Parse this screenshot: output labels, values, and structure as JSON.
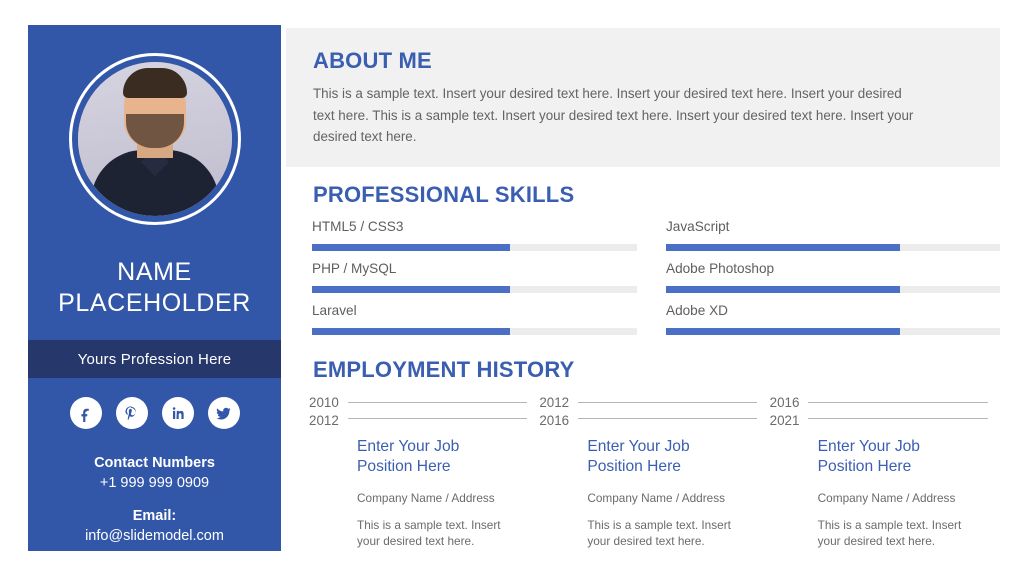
{
  "sidebar": {
    "avatar_alt": "profile-photo",
    "name_line1": "NAME",
    "name_line2": "PLACEHOLDER",
    "profession": "Yours Profession Here",
    "socials": [
      {
        "name": "facebook-icon",
        "label": "Facebook"
      },
      {
        "name": "pinterest-icon",
        "label": "Pinterest"
      },
      {
        "name": "linkedin-icon",
        "label": "LinkedIn"
      },
      {
        "name": "twitter-icon",
        "label": "Twitter"
      }
    ],
    "contact": {
      "phone_label": "Contact Numbers",
      "phone_value": "+1 999 999 0909",
      "email_label": "Email:",
      "email_value": "info@slidemodel.com"
    }
  },
  "about": {
    "title": "ABOUT ME",
    "body": "This is a sample text. Insert your desired text here. Insert your desired text here. Insert your desired text here. This is a sample text. Insert your desired text here. Insert your desired text here. Insert your desired text here."
  },
  "skills": {
    "title": "PROFESSIONAL SKILLS",
    "items": [
      {
        "name": "HTML5 / CSS3",
        "level": 61,
        "column": "left"
      },
      {
        "name": "JavaScript",
        "level": 70,
        "column": "right"
      },
      {
        "name": "PHP / MySQL",
        "level": 61,
        "column": "left"
      },
      {
        "name": "Adobe Photoshop",
        "level": 70,
        "column": "right"
      },
      {
        "name": "Laravel",
        "level": 61,
        "column": "left"
      },
      {
        "name": "Adobe XD",
        "level": 70,
        "column": "right"
      }
    ]
  },
  "employment": {
    "title": "EMPLOYMENT HISTORY",
    "entries": [
      {
        "year_from": "2010",
        "year_to": "2012",
        "role_line1": "Enter Your Job",
        "role_line2": "Position Here",
        "company": "Company Name / Address",
        "description": "This is a sample text. Insert your desired text here."
      },
      {
        "year_from": "2012",
        "year_to": "2016",
        "role_line1": "Enter Your Job",
        "role_line2": "Position Here",
        "company": "Company Name / Address",
        "description": "This is a sample text. Insert your desired text here."
      },
      {
        "year_from": "2016",
        "year_to": "2021",
        "role_line1": "Enter Your Job",
        "role_line2": "Position Here",
        "company": "Company Name / Address",
        "description": "This is a sample text. Insert your desired text here."
      }
    ]
  },
  "theme": {
    "sidebar_blue": "#3357a8",
    "band_navy": "#25376b",
    "heading_blue": "#3a5eb0",
    "bar_fill": "#4a6fc4",
    "bar_track": "#ececec",
    "panel_gray": "#f1f1f1"
  }
}
